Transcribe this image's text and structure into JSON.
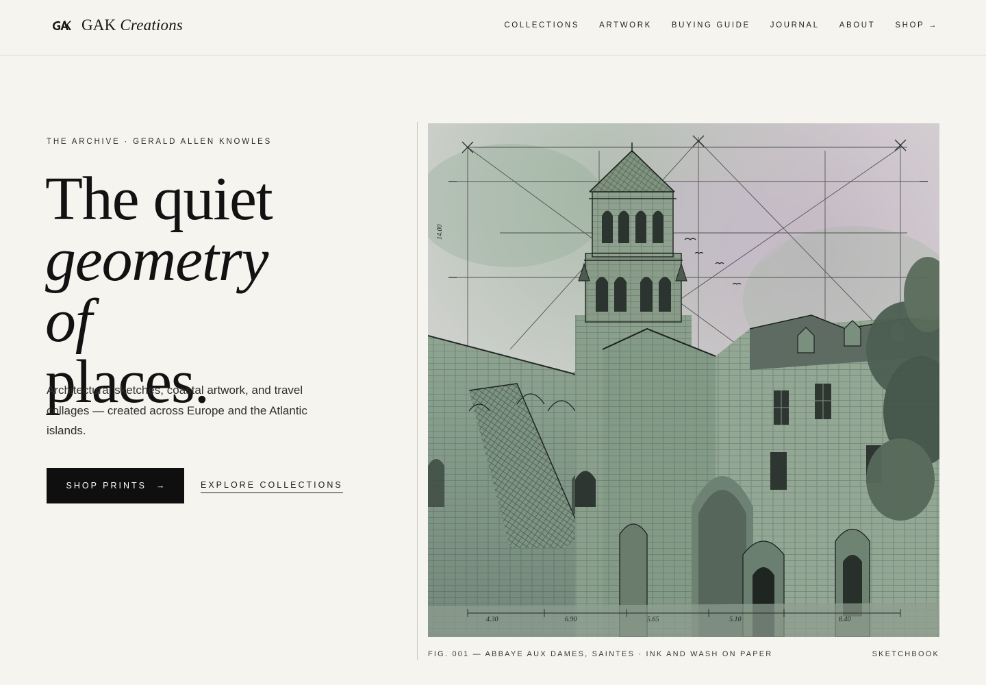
{
  "brand": {
    "mark": "GAK",
    "name": "GAK",
    "name_italic": "Creations"
  },
  "nav": {
    "items": [
      {
        "label": "COLLECTIONS"
      },
      {
        "label": "ARTWORK"
      },
      {
        "label": "BUYING GUIDE"
      },
      {
        "label": "JOURNAL"
      },
      {
        "label": "ABOUT"
      },
      {
        "label": "SHOP →"
      }
    ]
  },
  "hero": {
    "eyebrow": "THE ARCHIVE · GERALD ALLEN KNOWLES",
    "headline_line1": "The quiet",
    "headline_line2": "geometry",
    "headline_line3_italic": "of",
    "headline_line3_rest": " places.",
    "lede": "Architectural sketches, coastal artwork, and travel collages — created across Europe and the Atlantic islands.",
    "primary_cta": "SHOP PRINTS",
    "primary_cta_arrow": "→",
    "secondary_cta": "EXPLORE COLLECTIONS"
  },
  "artwork": {
    "caption": "FIG. 001 — ABBAYE AUX DAMES, SAINTES · INK AND WASH ON PAPER",
    "tag": "SKETCHBOOK",
    "measurements": [
      "4.30",
      "6.90",
      "5.65",
      "5.10",
      "8.40"
    ],
    "side_measure": "14.00",
    "colors": {
      "wash_green": "#8fa592",
      "wash_mauve": "#b8a9b6",
      "ink": "#2b302c",
      "paper": "#d9d6d2"
    }
  }
}
